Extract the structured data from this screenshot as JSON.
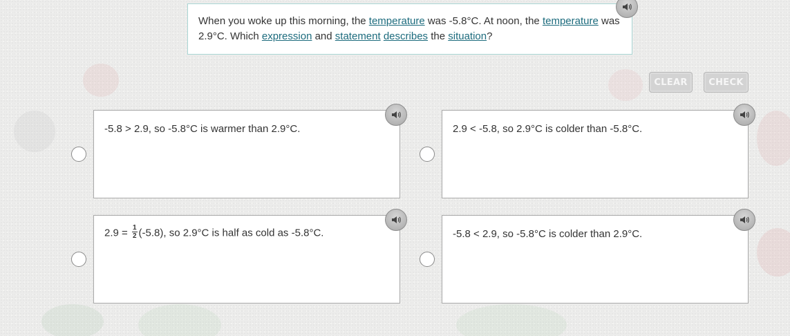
{
  "question": {
    "parts": [
      {
        "text": "When you woke up this morning, the ",
        "link": false
      },
      {
        "text": "temperature",
        "link": true
      },
      {
        "text": " was -5.8°C. At noon, the ",
        "link": false
      },
      {
        "text": "temperature",
        "link": true
      },
      {
        "text": " was 2.9°C. Which ",
        "link": false
      },
      {
        "text": "expression",
        "link": true
      },
      {
        "text": " and ",
        "link": false
      },
      {
        "text": "statement",
        "link": true
      },
      {
        "text": " ",
        "link": false
      },
      {
        "text": "describes",
        "link": true
      },
      {
        "text": " the ",
        "link": false
      },
      {
        "text": "situation",
        "link": true
      },
      {
        "text": "?",
        "link": false
      }
    ]
  },
  "buttons": {
    "clear": "CLEAR",
    "check": "CHECK"
  },
  "options": [
    {
      "text": "-5.8 > 2.9, so -5.8°C is warmer than 2.9°C."
    },
    {
      "text": "2.9 < -5.8, so 2.9°C is colder than -5.8°C."
    },
    {
      "prefix": "2.9 = ",
      "frac_num": "1",
      "frac_den": "2",
      "suffix": "(-5.8), so 2.9°C is half as cold as -5.8°C."
    },
    {
      "text": "-5.8 < 2.9, so -5.8°C is colder than 2.9°C."
    }
  ],
  "icons": {
    "audio": "speaker-icon",
    "radio": "radio-circle-icon"
  },
  "colors": {
    "link": "#1c6b7d",
    "question_border": "#a9d6d4",
    "button_disabled": "#d3d3d3"
  }
}
